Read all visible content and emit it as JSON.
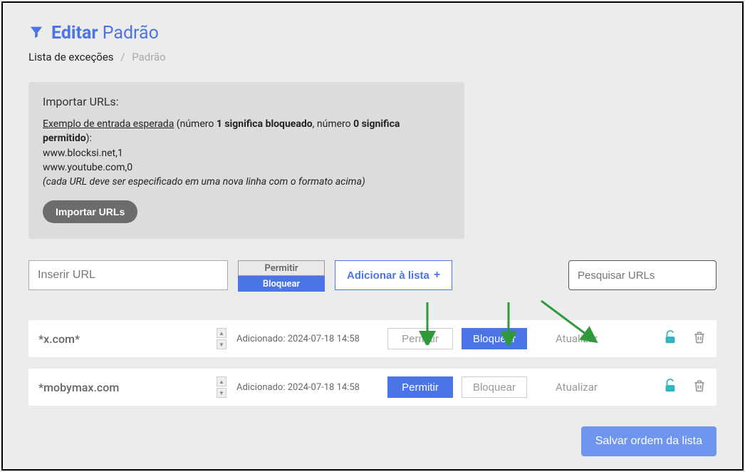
{
  "header": {
    "title_strong": "Editar",
    "title_rest": "Padrão"
  },
  "breadcrumb": {
    "root": "Lista de exceções",
    "current": "Padrão"
  },
  "import_panel": {
    "title": "Importar URLs:",
    "link": "Exemplo de entrada esperada",
    "desc_prefix": " (número ",
    "b1": "1 significa bloqueado",
    "mid": ", número ",
    "b0": "0 significa permitido",
    "desc_suffix": "):",
    "ex1": "www.blocksi.net,1",
    "ex2": "www.youtube.com,0",
    "note": "(cada URL deve ser especificado em uma nova linha com o formato acima)",
    "button": "Importar URLs"
  },
  "controls": {
    "url_placeholder": "Inserir URL",
    "permit": "Permitir",
    "block": "Bloquear",
    "add": "Adicionar à lista",
    "search_placeholder": "Pesquisar URLs"
  },
  "rows": [
    {
      "url": "*x.com*",
      "added_label": "Adicionado: 2024-07-18 14:58",
      "permit": "Permitir",
      "block": "Bloquear",
      "update": "Atualizar",
      "state": "block"
    },
    {
      "url": "*mobymax.com",
      "added_label": "Adicionado: 2024-07-18 14:58",
      "permit": "Permitir",
      "block": "Bloquear",
      "update": "Atualizar",
      "state": "permit"
    }
  ],
  "save_label": "Salvar ordem da lista",
  "colors": {
    "accent": "#4a74e8",
    "teal": "#2fb4c2",
    "arrow": "#2e9a3a"
  }
}
